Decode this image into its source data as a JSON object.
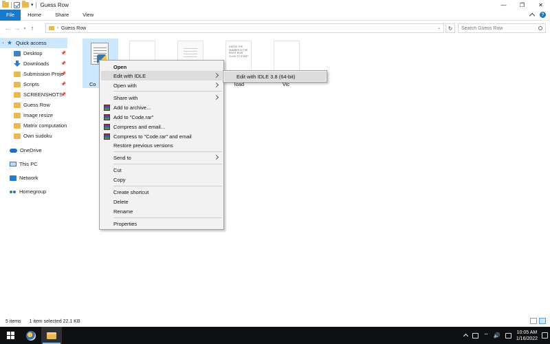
{
  "window": {
    "title": "Guess Row",
    "controls": [
      "—",
      "❐",
      "✕"
    ]
  },
  "ribbon": {
    "tabs": [
      "File",
      "Home",
      "Share",
      "View"
    ]
  },
  "address": {
    "path": "Guess Row",
    "search_placeholder": "Search Guess Row"
  },
  "sidebar": {
    "quick_access": "Quick access",
    "items": [
      {
        "label": "Desktop",
        "icon": "desktop-icon",
        "pinned": true
      },
      {
        "label": "Downloads",
        "icon": "download-icon",
        "pinned": true
      },
      {
        "label": "Submission Proje",
        "icon": "folder-icon",
        "pinned": true
      },
      {
        "label": "Scripts",
        "icon": "folder-icon",
        "pinned": true
      },
      {
        "label": "SCREENSHOTS",
        "icon": "folder-icon",
        "pinned": true
      },
      {
        "label": "Guess Row",
        "icon": "folder-icon",
        "pinned": false
      },
      {
        "label": "Image resize",
        "icon": "folder-icon",
        "pinned": false
      },
      {
        "label": "Matrix computation",
        "icon": "folder-icon",
        "pinned": false
      },
      {
        "label": "Own sudoku",
        "icon": "folder-icon",
        "pinned": false
      }
    ],
    "onedrive": "OneDrive",
    "this_pc": "This PC",
    "network": "Network",
    "homegroup": "Homegroup"
  },
  "files": [
    {
      "label": "Co",
      "type": "python"
    },
    {
      "label": "",
      "type": "blank"
    },
    {
      "label": "",
      "type": "text"
    },
    {
      "label": "load",
      "type": "text-content",
      "preview": "GUESS THE NUMBER IN THE RIGHT ROW  CLICK TO START"
    },
    {
      "label": "Vic",
      "type": "blank"
    }
  ],
  "context_menu": {
    "open": "Open",
    "edit_with_idle": "Edit with IDLE",
    "open_with": "Open with",
    "share_with": "Share with",
    "add_to_archive": "Add to archive...",
    "add_to_code_rar": "Add to \"Code.rar\"",
    "compress_and_email": "Compress and email...",
    "compress_to_code_rar_email": "Compress to \"Code.rar\" and email",
    "restore_previous_versions": "Restore previous versions",
    "send_to": "Send to",
    "cut": "Cut",
    "copy": "Copy",
    "create_shortcut": "Create shortcut",
    "delete": "Delete",
    "rename": "Rename",
    "properties": "Properties"
  },
  "submenu": {
    "edit_with_idle_38": "Edit with IDLE 3.8 (64-bit)"
  },
  "status": {
    "items_count": "5 items",
    "selected": "1 item selected  22.1 KB"
  },
  "taskbar": {
    "time": "10:05 AM",
    "date": "1/16/2022"
  }
}
